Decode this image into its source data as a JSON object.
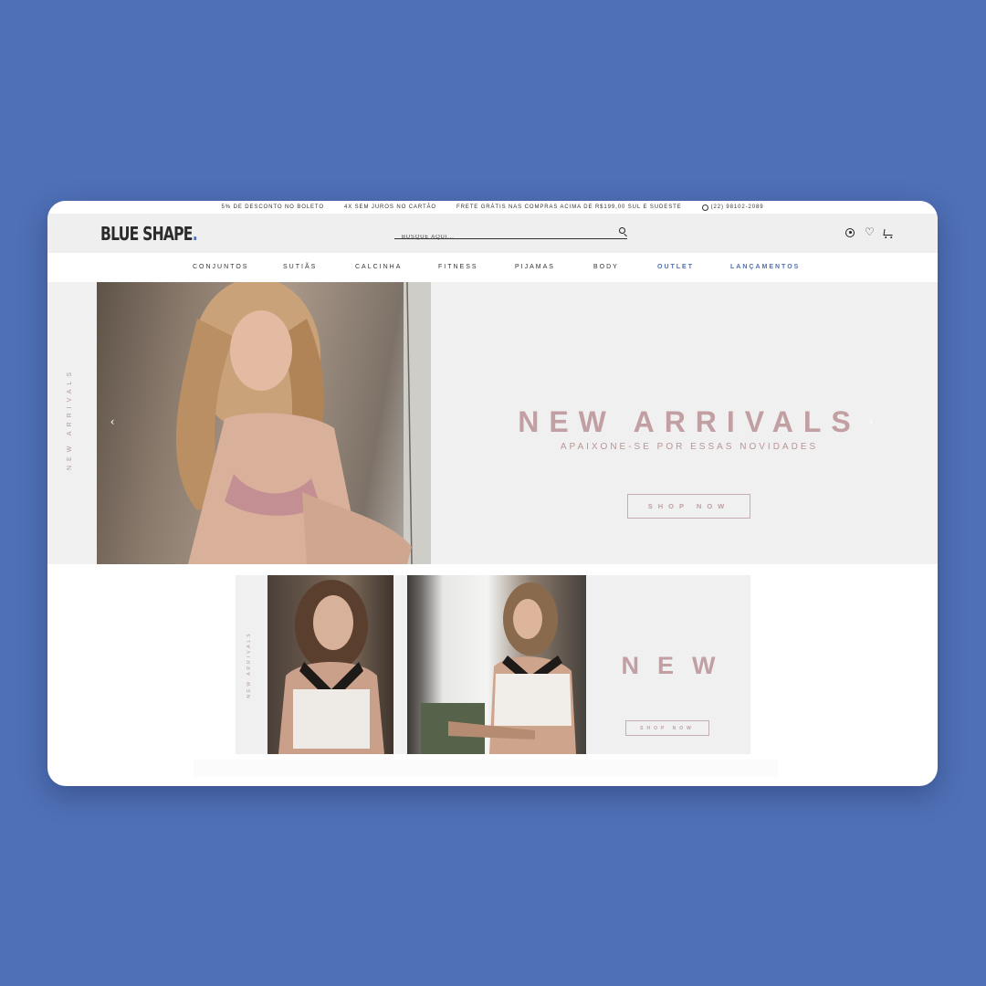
{
  "topbar": {
    "promos": [
      "5% DE DESCONTO NO BOLETO",
      "4X SEM JUROS NO CARTÃO",
      "FRETE GRÁTIS NAS COMPRAS ACIMA DE R$199,00 SUL E SUDESTE"
    ],
    "phone": "(22) 98102-2089"
  },
  "header": {
    "logo_text": "BLUE SHAPE",
    "logo_dot": ".",
    "search_placeholder": "BUSQUE AQUI..."
  },
  "nav": {
    "items": [
      "CONJUNTOS",
      "SUTIÃS",
      "CALCINHA",
      "FITNESS",
      "PIJAMAS",
      "BODY",
      "OUTLET",
      "LANÇAMENTOS"
    ]
  },
  "hero": {
    "side_label": "NEW ARRIVALS",
    "title": "NEW ARRIVALS",
    "subtitle": "APAIXONE-SE POR ESSAS NOVIDADES",
    "button": "SHOP NOW",
    "prev_arrow": "‹",
    "next_arrow": "›"
  },
  "banner2": {
    "side_label": "NEW ARRIVALS",
    "title": "NEW",
    "button": "SHOP NOW"
  },
  "colors": {
    "background": "#4f70b6",
    "accent_rose": "#c19fa2",
    "accent_blue": "#4f70b6"
  }
}
